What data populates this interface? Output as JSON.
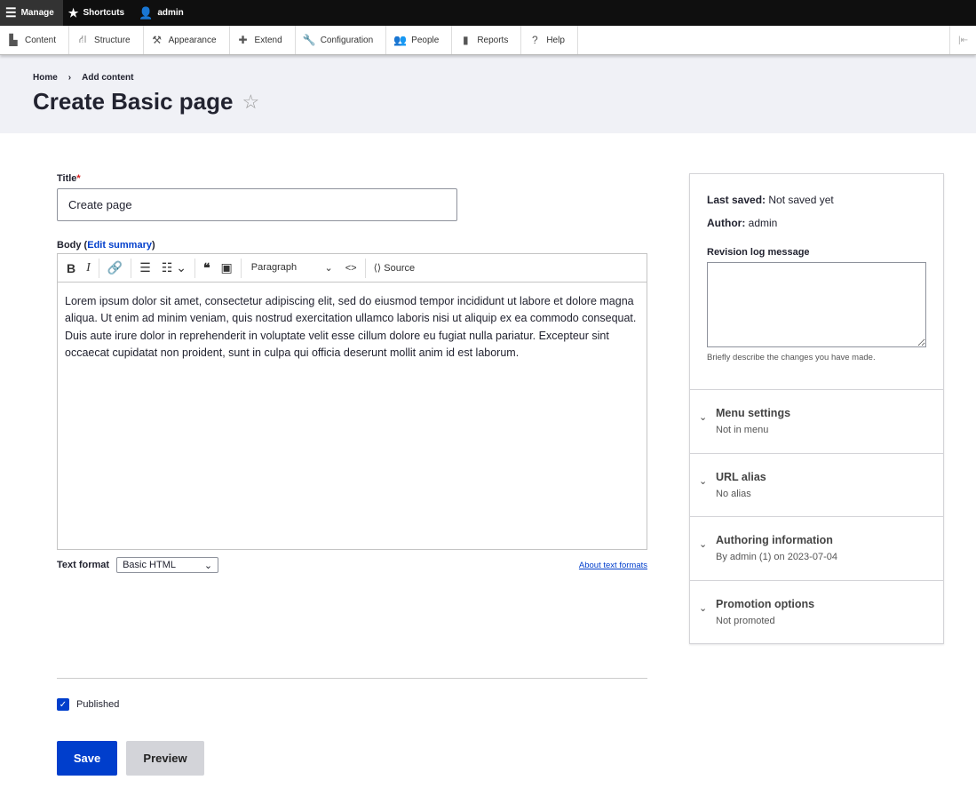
{
  "toolbar": {
    "manage": "Manage",
    "shortcuts": "Shortcuts",
    "user": "admin"
  },
  "tray": [
    {
      "label": "Content",
      "icon": "▙"
    },
    {
      "label": "Structure",
      "icon": "⛙"
    },
    {
      "label": "Appearance",
      "icon": "⚒"
    },
    {
      "label": "Extend",
      "icon": "✚"
    },
    {
      "label": "Configuration",
      "icon": "🔧"
    },
    {
      "label": "People",
      "icon": "👥"
    },
    {
      "label": "Reports",
      "icon": "▮"
    },
    {
      "label": "Help",
      "icon": "?"
    }
  ],
  "breadcrumb": [
    "Home",
    "Add content"
  ],
  "page_title": "Create Basic page",
  "form": {
    "title_label": "Title",
    "title_value": "Create page",
    "body_label": "Body",
    "edit_summary": "Edit summary",
    "editor": {
      "paragraph": "Paragraph",
      "source": "Source",
      "content": "Lorem ipsum dolor sit amet, consectetur adipiscing elit, sed do eiusmod tempor incididunt ut labore et dolore magna aliqua. Ut enim ad minim veniam, quis nostrud exercitation ullamco laboris nisi ut aliquip ex ea commodo consequat. Duis aute irure dolor in reprehenderit in voluptate velit esse cillum dolore eu fugiat nulla pariatur. Excepteur sint occaecat cupidatat non proident, sunt in culpa qui officia deserunt mollit anim id est laborum."
    },
    "text_format_label": "Text format",
    "text_format_value": "Basic HTML",
    "about_formats": "About text formats",
    "published": "Published",
    "published_checked": true,
    "save": "Save",
    "preview": "Preview"
  },
  "sidebar": {
    "last_saved_label": "Last saved:",
    "last_saved": "Not saved yet",
    "author_label": "Author:",
    "author": "admin",
    "revision_label": "Revision log message",
    "revision_desc": "Briefly describe the changes you have made.",
    "sections": [
      {
        "title": "Menu settings",
        "summary": "Not in menu"
      },
      {
        "title": "URL alias",
        "summary": "No alias"
      },
      {
        "title": "Authoring information",
        "summary": "By admin (1) on 2023-07-04"
      },
      {
        "title": "Promotion options",
        "summary": "Not promoted"
      }
    ]
  }
}
